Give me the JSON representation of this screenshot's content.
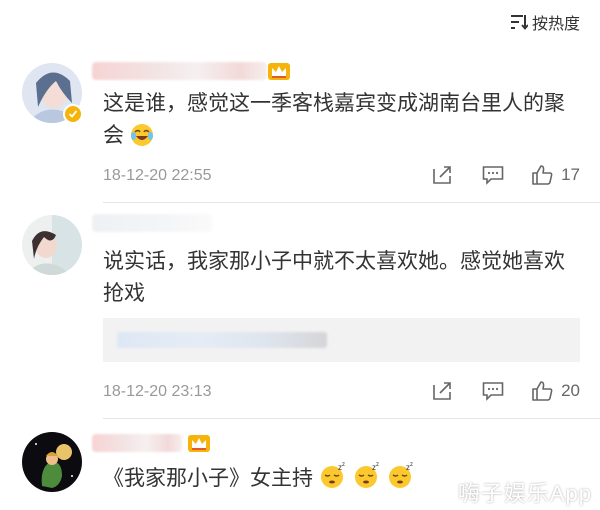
{
  "header": {
    "sort_label": "按热度",
    "sort_icon": "sort-icon"
  },
  "comments": [
    {
      "text": "这是谁，感觉这一季客栈嘉宾变成湖南台里人的聚会",
      "text_emoji": "laughing-tears-emoji",
      "time": "18-12-20 22:55",
      "likes": "17",
      "verified": true
    },
    {
      "text": "说实话，我家那小子中就不太喜欢她。感觉她喜欢抢戏",
      "time": "18-12-20 23:13",
      "likes": "20",
      "verified": false
    },
    {
      "text": "《我家那小子》女主持",
      "text_emoji": "sleepy-emoji",
      "verified": false
    }
  ],
  "watermark": "嗨子娱乐App",
  "colors": {
    "accent_gold": "#f6b40a",
    "meta_gray": "#999999",
    "text": "#333333",
    "divider": "#e6e6e6"
  }
}
